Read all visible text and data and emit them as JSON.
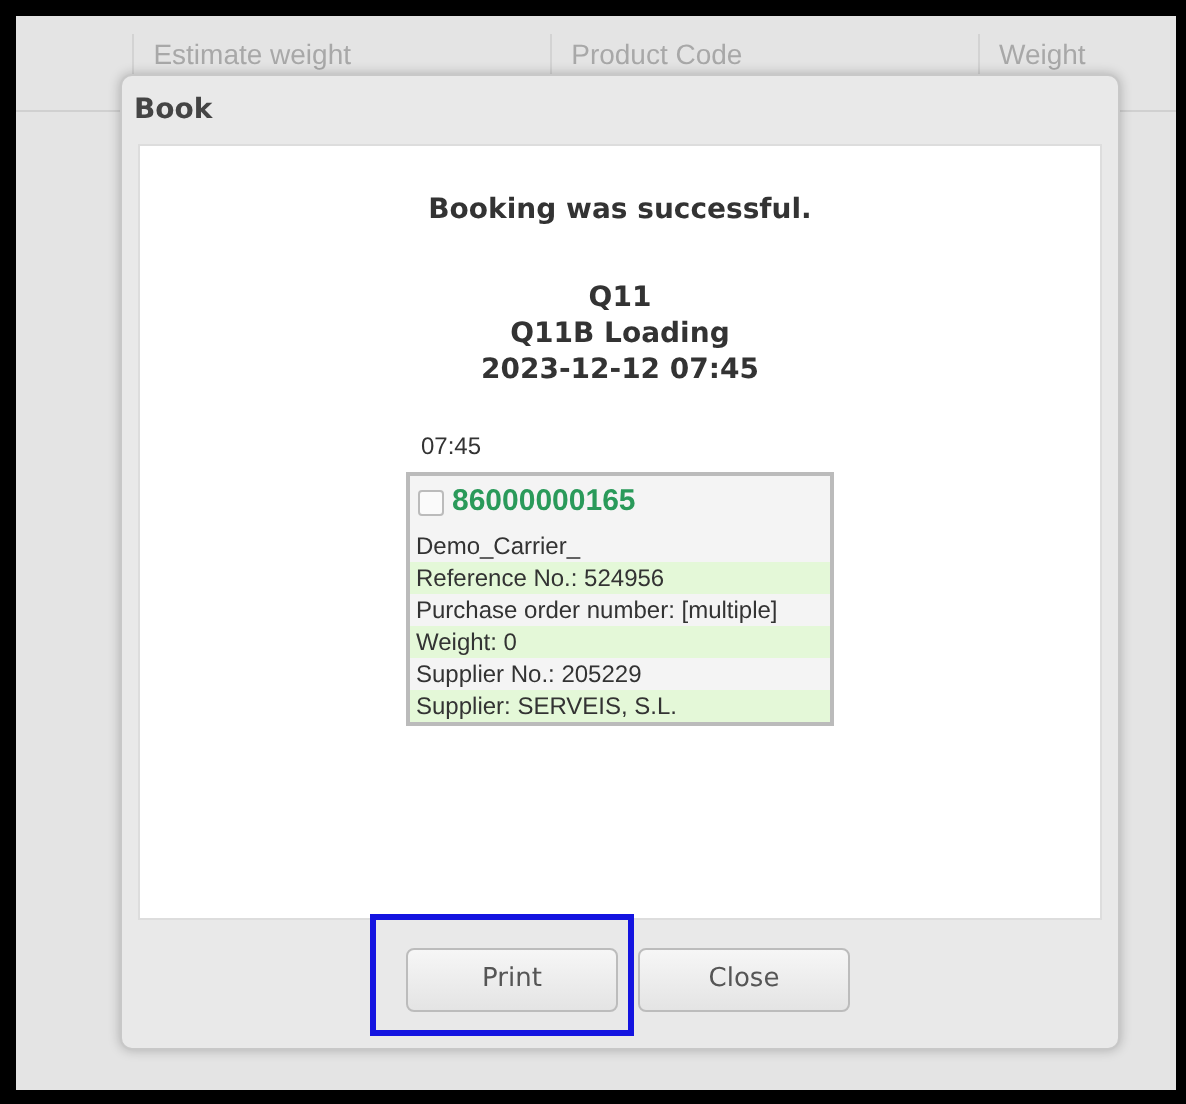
{
  "background_table": {
    "columns": [
      "Estimate weight",
      "Product Code",
      "Weight"
    ]
  },
  "dialog": {
    "title": "Book",
    "message": "Booking was successful.",
    "details": [
      "Q11",
      "Q11B Loading",
      "2023-12-12 07:45"
    ],
    "slot_time": "07:45",
    "booking_card": {
      "checked": false,
      "number": "86000000165",
      "lines": [
        {
          "text": "Demo_Carrier_",
          "shaded": false
        },
        {
          "text": "Reference No.: 524956",
          "shaded": true
        },
        {
          "text": "Purchase order number: [multiple]",
          "shaded": false
        },
        {
          "text": "Weight: 0",
          "shaded": true
        },
        {
          "text": "Supplier No.: 205229",
          "shaded": false
        },
        {
          "text": "Supplier: SERVEIS, S.L.",
          "shaded": true
        }
      ]
    },
    "buttons": [
      {
        "label": "Print",
        "highlighted": true
      },
      {
        "label": "Close",
        "highlighted": false
      }
    ]
  }
}
